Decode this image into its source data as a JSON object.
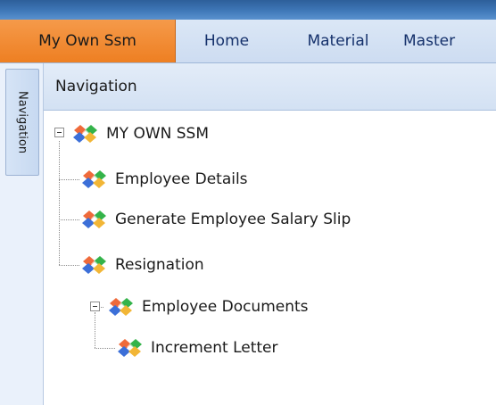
{
  "ribbon": {
    "tabs": [
      {
        "label": "My Own Ssm",
        "active": true
      },
      {
        "label": "Home",
        "active": false
      },
      {
        "label": "Material",
        "active": false
      },
      {
        "label": "Master",
        "active": false
      }
    ]
  },
  "sidebar": {
    "tab_label": "Navigation"
  },
  "navigation": {
    "header": "Navigation",
    "tree": {
      "root": "MY OWN SSM",
      "items": [
        "Employee Details",
        "Generate Employee Salary Slip",
        "Resignation",
        "Employee Documents"
      ],
      "sub_items": [
        "Increment Letter"
      ]
    }
  },
  "colors": {
    "active_tab": "#ee7f22",
    "highlight": "#fbfb1e",
    "titlebar": "#3f78b8"
  },
  "icons": {
    "tree_node": "diamond-cluster-icon"
  }
}
